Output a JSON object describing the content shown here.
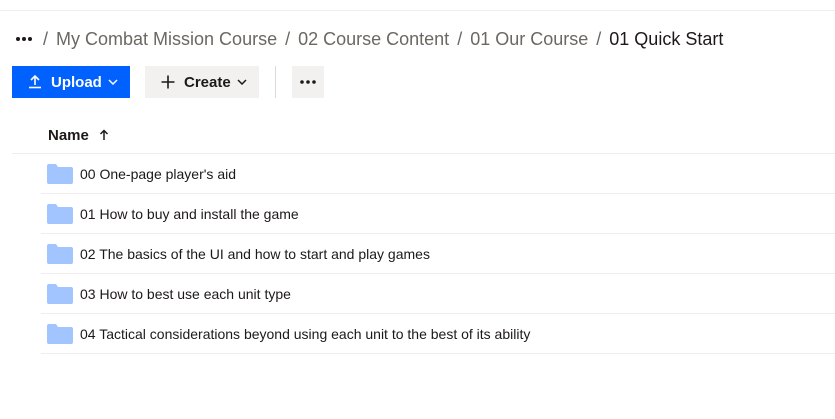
{
  "breadcrumb": {
    "items": [
      "My Combat Mission Course",
      "02 Course Content",
      "01 Our Course"
    ],
    "current": "01 Quick Start",
    "separator": "/"
  },
  "toolbar": {
    "upload_label": "Upload",
    "create_label": "Create"
  },
  "table": {
    "name_header": "Name",
    "sort": "ascending",
    "rows": [
      {
        "name": "00 One-page player's aid",
        "icon": "folder-icon"
      },
      {
        "name": "01 How to buy and install the game",
        "icon": "folder-icon"
      },
      {
        "name": "02 The basics of the UI and how to start and play games",
        "icon": "folder-icon"
      },
      {
        "name": "03 How to best use each unit type",
        "icon": "folder-icon"
      },
      {
        "name": "04 Tactical considerations beyond using each unit to the best of its ability",
        "icon": "folder-icon"
      }
    ]
  },
  "colors": {
    "accent": "#0061fe",
    "folder": "#a3c5ff",
    "secondary_button": "#f3f1ef",
    "text": "#1e1919",
    "muted_text": "#6b6763"
  }
}
